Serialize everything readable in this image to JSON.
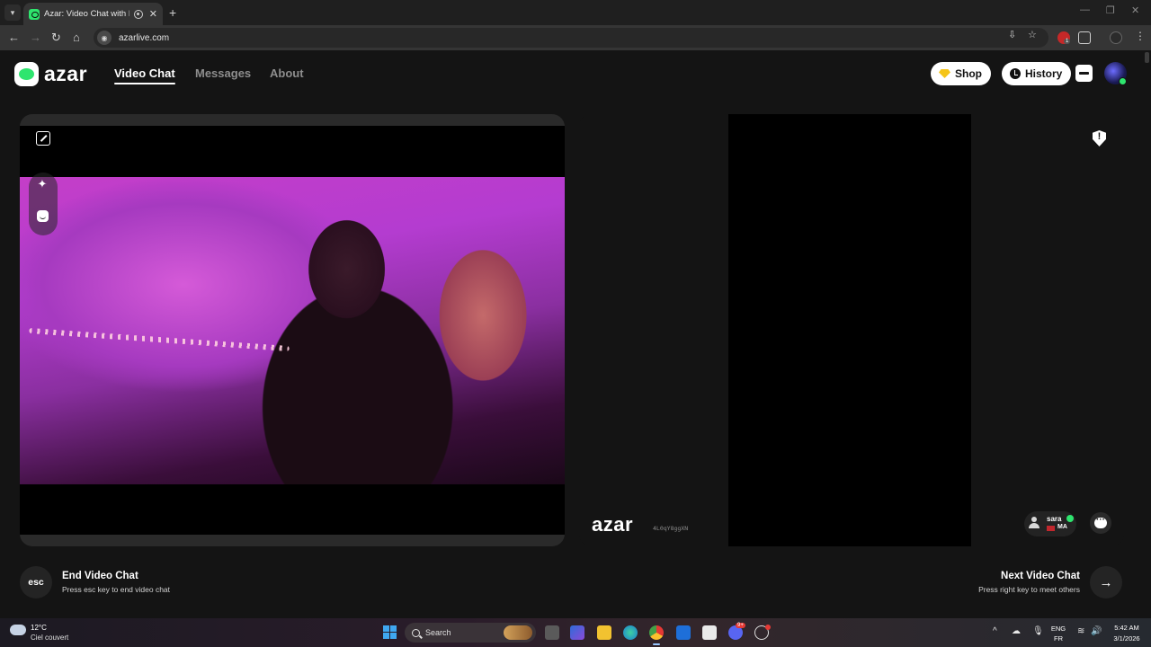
{
  "browser": {
    "tab_title": "Azar: Video Chat with New",
    "url": "azarlive.com",
    "extension_badge": "1"
  },
  "header": {
    "logo_text": "azar",
    "nav": [
      {
        "label": "Video Chat",
        "active": true
      },
      {
        "label": "Messages",
        "active": false
      },
      {
        "label": "About",
        "active": false
      }
    ],
    "shop_label": "Shop",
    "history_label": "History"
  },
  "remote": {
    "watermark_logo": "azar",
    "watermark_id": "4L0qY8ggXN",
    "partner_name": "sara",
    "partner_country": "MA"
  },
  "controls": {
    "esc_key": "esc",
    "end_title": "End Video Chat",
    "end_subtitle": "Press esc key to end video chat",
    "next_title": "Next Video Chat",
    "next_subtitle": "Press right key to meet others"
  },
  "taskbar": {
    "weather_temp": "12°C",
    "weather_condition": "Ciel couvert",
    "search_placeholder": "Search",
    "language_top": "ENG",
    "language_bottom": "FR",
    "time": "5:42 AM",
    "date": "3/1/2026",
    "discord_badge": "9+"
  },
  "colors": {
    "brand_green": "#2ee56e",
    "background": "#141414",
    "panel": "#2a2a2a"
  }
}
